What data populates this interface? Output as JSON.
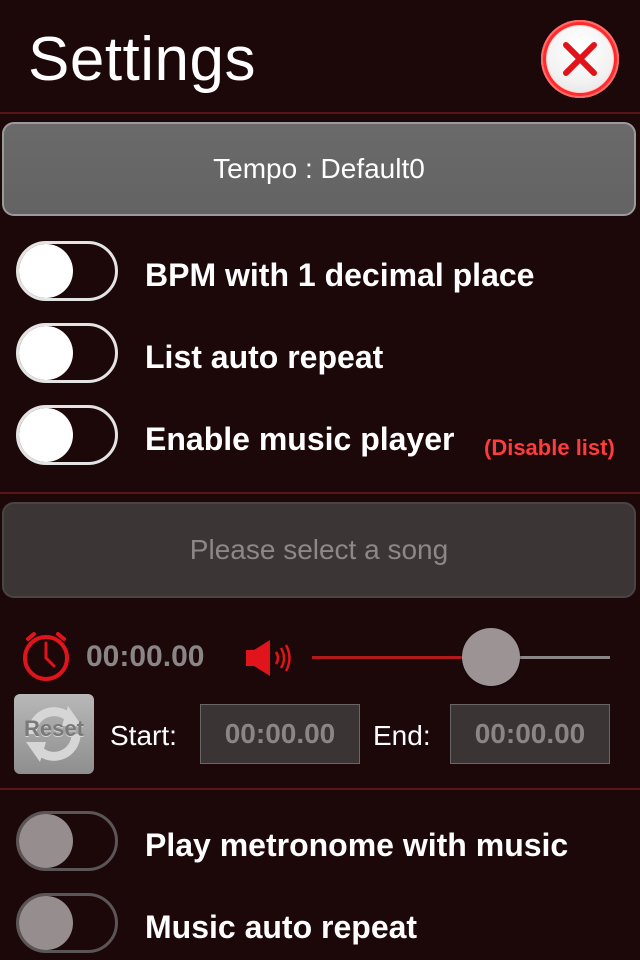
{
  "header": {
    "title": "Settings",
    "close_icon": "close-icon"
  },
  "tempo": {
    "label": "Tempo : Default0"
  },
  "toggles": [
    {
      "label": "BPM with 1 decimal place",
      "on": false
    },
    {
      "label": "List auto repeat",
      "on": false
    },
    {
      "label": "Enable music player",
      "on": false,
      "note": "(Disable list)"
    }
  ],
  "music": {
    "song_placeholder": "Please select a song",
    "current_time": "00:00.00",
    "clock_icon": "clock-icon",
    "volume_icon": "speaker-icon",
    "volume_level": 0.56,
    "reset_label": "Reset",
    "start_label": "Start:",
    "start_value": "00:00.00",
    "end_label": "End:",
    "end_value": "00:00.00"
  },
  "music_toggles": [
    {
      "label": "Play metronome with music",
      "on": false,
      "enabled": false
    },
    {
      "label": "Music auto repeat",
      "on": false,
      "enabled": false
    }
  ],
  "colors": {
    "background": "#1d0809",
    "accent_red": "#e0141a",
    "note_red": "#ff3b3b"
  }
}
